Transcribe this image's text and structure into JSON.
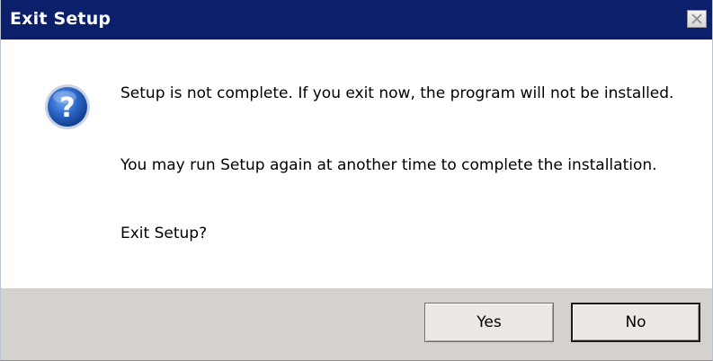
{
  "window": {
    "title": "Exit Setup"
  },
  "icons": {
    "dialog_icon": "question-icon",
    "close": "close-icon"
  },
  "message": {
    "line1": "Setup is not complete. If you exit now, the program will not be installed.",
    "line2": "You may run Setup again at another time to complete the installation.",
    "line3": "Exit Setup?"
  },
  "buttons": {
    "yes_label": "Yes",
    "no_label": "No"
  },
  "colors": {
    "titlebar": "#0b1f6b",
    "footer": "#d5d2cd",
    "icon_blue": "#1f5fbf"
  }
}
